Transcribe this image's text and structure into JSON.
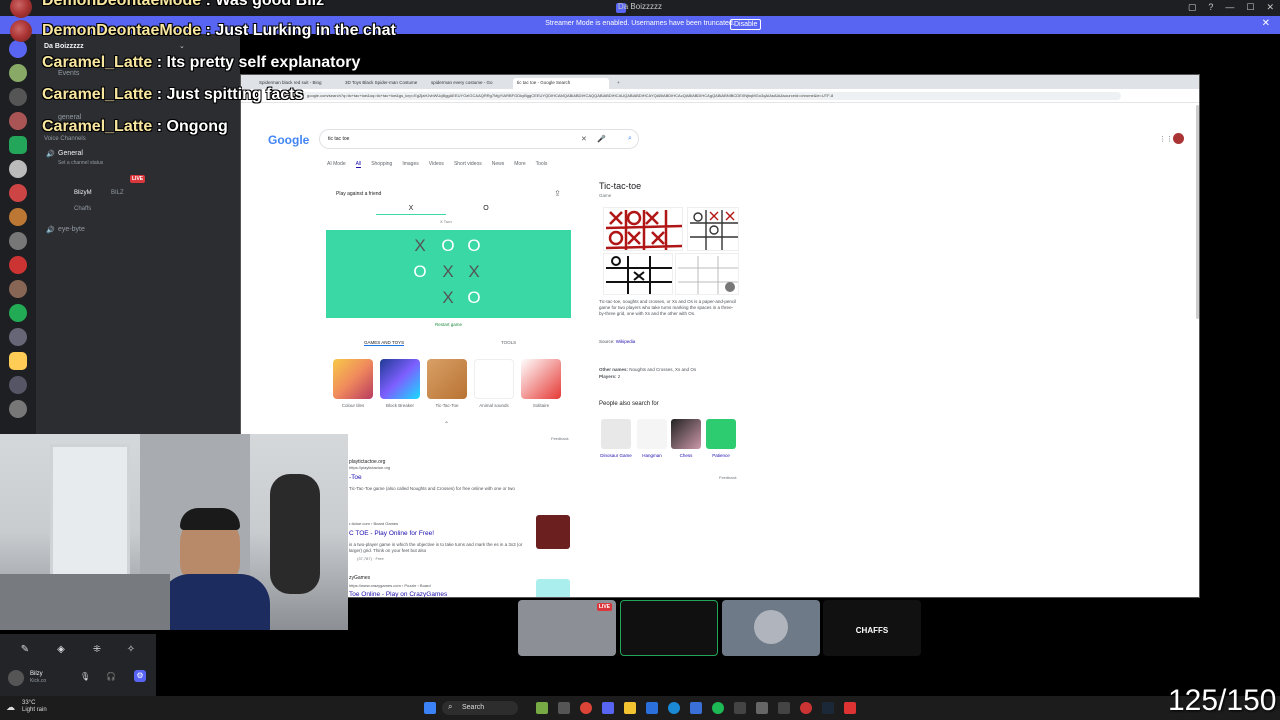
{
  "window": {
    "title": "Da Boizzzzz"
  },
  "banner": {
    "text": "Streamer Mode is enabled. Usernames have been truncated.",
    "disable_label": "Disable"
  },
  "sidebar": {
    "server_name": "Da Boizzzzz",
    "items": [
      {
        "label": "Events"
      },
      {
        "label": "general"
      },
      {
        "label": "Voice Channels"
      },
      {
        "label": "General"
      },
      {
        "label": "Set a channel status"
      },
      {
        "label": "BlizyM"
      },
      {
        "label": "BILZ"
      },
      {
        "label": "Chaffs"
      },
      {
        "label": "eye-byte"
      }
    ],
    "live_badge": "LIVE"
  },
  "chat": [
    {
      "user": "DemonDeontaeMode",
      "message": "Was good Bilz"
    },
    {
      "user": "DemonDeontaeMode",
      "message": "Just Lurking in the chat"
    },
    {
      "user": "Caramel_Latte",
      "message": "Its pretty self explanatory"
    },
    {
      "user": "Caramel_Latte",
      "message": "Just spitting facts"
    },
    {
      "user": "Caramel_Latte",
      "message": "Ongong"
    }
  ],
  "browser": {
    "tabs": [
      "Spiderman black red suit - Bing",
      "3D Toys Black Spider-man Costume",
      "spiderman every costume - Go",
      "tic tac toe - Google Search"
    ],
    "url": "google.com/search?q=tic+tac+toe&oq=tic+tac+toe&gs_lcrp=EgZjaHJvbWUqBggAEEUYOzIGCAAQRRg7MgYIARBFGDkyBggCEEUYQDIHCAMQABiABDIHCAQQABiABDIHCAUQABiABDIHCAYQABiABDIHCAcQABiABDIHCAgQABiABNIBCDE0NjhqMGo3qAIAsAIA&sourceid=chrome&ie=UTF-8",
    "google_logo": "Google",
    "query": "tic tac toe",
    "search_tabs": [
      "AI Mode",
      "All",
      "Shopping",
      "Images",
      "Videos",
      "Short videos",
      "News",
      "More",
      "Tools"
    ],
    "game": {
      "mode": "Play against a friend",
      "x_label": "X",
      "o_label": "O",
      "turn": "X Turn",
      "restart": "Restart game",
      "board": [
        "X",
        "O",
        "O",
        "O",
        "X",
        "X",
        "",
        "X",
        "O"
      ],
      "section_games": "GAMES AND TOYS",
      "section_tools": "TOOLS",
      "games": [
        "Colour tiles",
        "Block Breaker",
        "Tic-Tac-Toe",
        "Animal sounds",
        "Solitaire"
      ],
      "feedback": "Feedback"
    },
    "knowledge": {
      "title": "Tic-tac-toe",
      "subtitle": "Game",
      "description": "Tic-tac-toe, noughts and crosses, or Xs and Os is a paper-and-pencil game for two players who take turns marking the spaces in a three-by-three grid, one with Xs and the other with Os.",
      "source_label": "Source:",
      "source": "Wikipedia",
      "other_names_label": "Other names:",
      "other_names": "Noughts and Crosses, Xs and Os",
      "players_label": "Players:",
      "players": "2",
      "people_also": "People also search for",
      "related": [
        "Dinosaur Game",
        "Hangman",
        "Chess",
        "Patience"
      ],
      "feedback": "Feedback"
    },
    "results": [
      {
        "site": "playtictactoe.org",
        "url": "https://playtictactoe.org",
        "title": "-Toe",
        "snippet": "Tic-Tac-Toe game (also called Noughts and Crosses) for free online with one or two"
      },
      {
        "site": "r-tictoe.com",
        "url": "r-tictoe.com › Board Games",
        "title": "C TOE - Play Online for Free!",
        "snippet": "is a two-player game in which the objective is to take turns and mark the es in a 3x3 (or larger) grid. Think on your feet but also",
        "rating": "(37,787) · Free"
      },
      {
        "site": "zyGames",
        "url": "https://www.crazygames.com › Puzzle › Board",
        "title": "Toe Online - Play on CrazyGames"
      }
    ]
  },
  "participants": [
    {
      "name": "screen-share",
      "live": "LIVE"
    },
    {
      "name": "camera"
    },
    {
      "name": "user"
    },
    {
      "name": "CHAFFS"
    }
  ],
  "user_panel": {
    "name": "Bilzy",
    "status": "Kick.co"
  },
  "taskbar": {
    "weather_temp": "33°C",
    "weather_desc": "Light rain",
    "search": "Search"
  },
  "counter": "125/150",
  "colors": {
    "blurple": "#5865f2",
    "board_green": "#3ad8a5",
    "live_red": "#da373c"
  }
}
